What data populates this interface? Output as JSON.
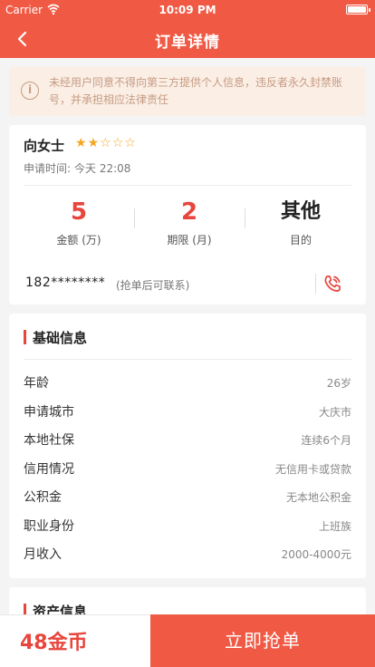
{
  "status_bar": {
    "carrier": "Carrier",
    "time": "10:09 PM"
  },
  "nav": {
    "title": "订单详情",
    "back_icon": "chevron-left-icon"
  },
  "notice": {
    "text": "未经用户同意不得向第三方提供个人信息，违反者永久封禁账号，并承担相应法律责任"
  },
  "user": {
    "name": "向女士",
    "rating": 2,
    "rating_max": 5,
    "apply_time_label": "申请时间:",
    "apply_time": "今天 22:08"
  },
  "stats": [
    {
      "value": "5",
      "label": "金额 (万)"
    },
    {
      "value": "2",
      "label": "期限 (月)"
    },
    {
      "value": "其他",
      "label": "目的"
    }
  ],
  "contact": {
    "phone": "182********",
    "hint": "(抢单后可联系)"
  },
  "basic_info": {
    "title": "基础信息",
    "rows": [
      {
        "key": "年龄",
        "value": "26岁"
      },
      {
        "key": "申请城市",
        "value": "大庆市"
      },
      {
        "key": "本地社保",
        "value": "连续6个月"
      },
      {
        "key": "信用情况",
        "value": "无信用卡或贷款"
      },
      {
        "key": "公积金",
        "value": "无本地公积金"
      },
      {
        "key": "职业身份",
        "value": "上班族"
      },
      {
        "key": "月收入",
        "value": "2000-4000元"
      }
    ]
  },
  "asset_info": {
    "title": "资产信息"
  },
  "bottom": {
    "coins": "48金币",
    "grab_label": "立即抢单"
  },
  "colors": {
    "brand": "#f05a45",
    "accent": "#e8453c",
    "star": "#f5a623",
    "notice_text": "#c69c83"
  }
}
